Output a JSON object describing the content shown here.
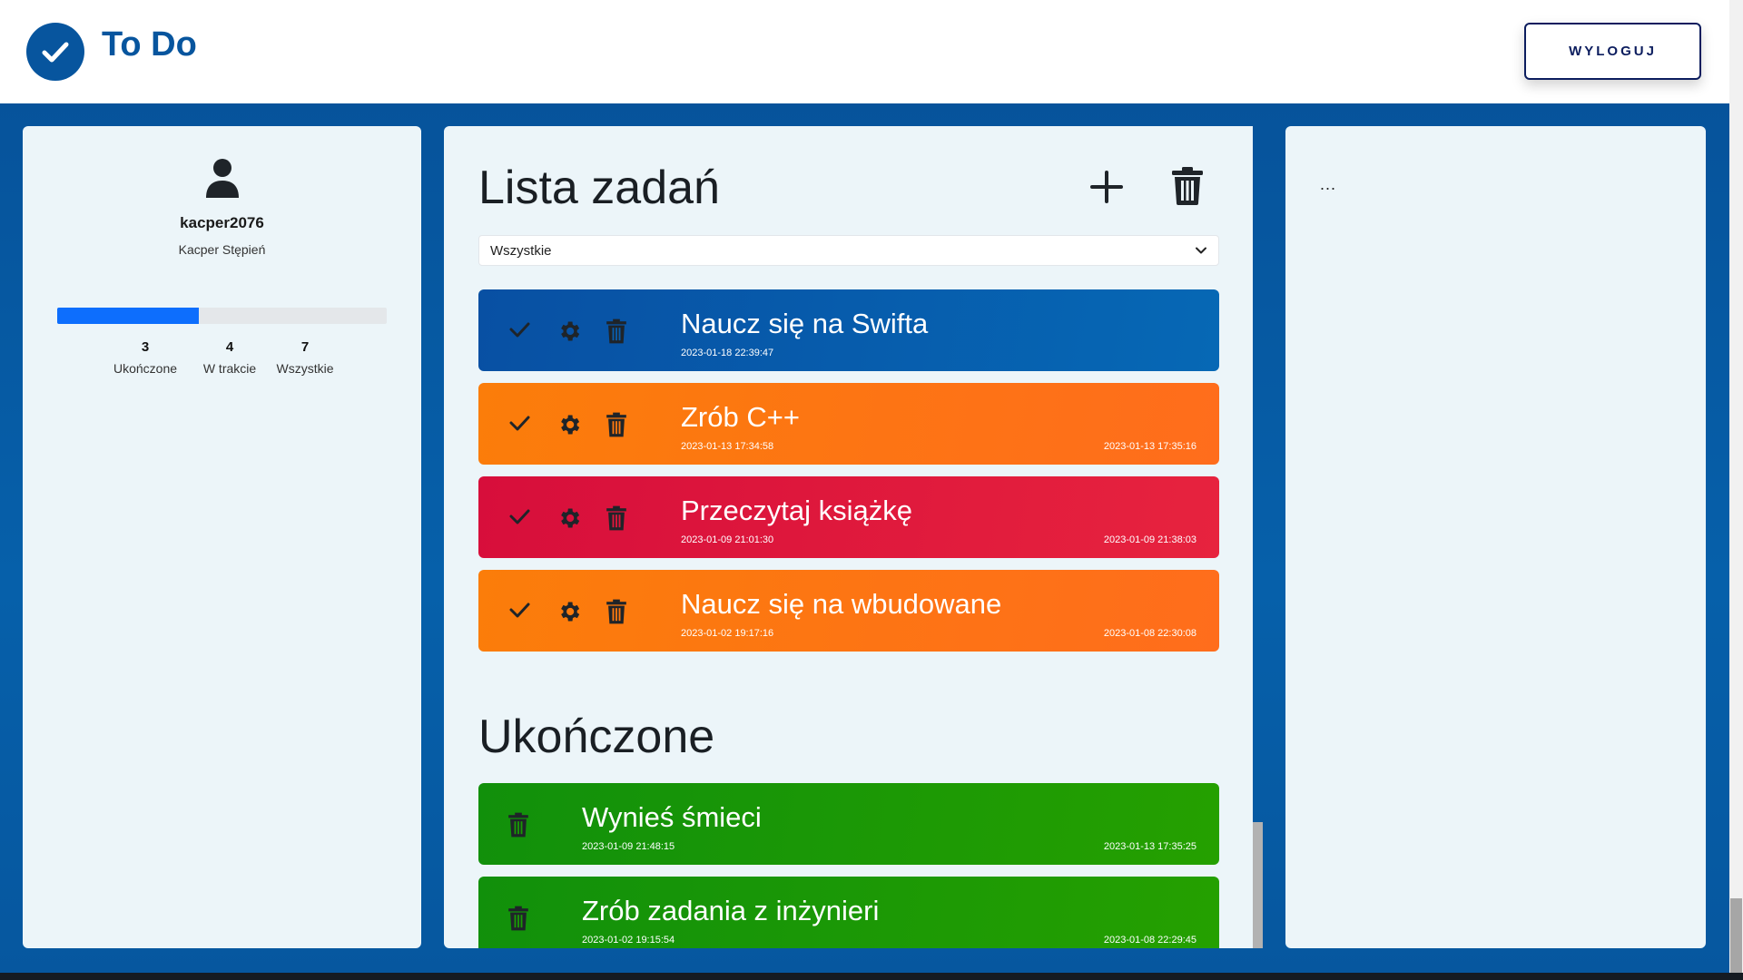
{
  "app": {
    "title": "To Do",
    "logout_label": "WYLOGUJ"
  },
  "profile": {
    "username": "kacper2076",
    "full_name": "Kacper Stępień",
    "progress_fraction": 0.43,
    "stats": [
      {
        "value": "3",
        "label": "Ukończone"
      },
      {
        "value": "4",
        "label": "W trakcie"
      },
      {
        "value": "7",
        "label": "Wszystkie"
      }
    ]
  },
  "task_list": {
    "title": "Lista zadań",
    "filter_value": "Wszystkie",
    "tasks": [
      {
        "title": "Naucz się na Swifta",
        "created": "2023-01-18 22:39:47",
        "deadline": "",
        "color": "#0a5dab"
      },
      {
        "title": "Zrób C++",
        "created": "2023-01-13 17:34:58",
        "deadline": "2023-01-13 17:35:16",
        "color": "#fd770f"
      },
      {
        "title": "Przeczytaj książkę",
        "created": "2023-01-09 21:01:30",
        "deadline": "2023-01-09 21:38:03",
        "color": "#dc163c"
      },
      {
        "title": "Naucz się na wbudowane",
        "created": "2023-01-02 19:17:16",
        "deadline": "2023-01-08 22:30:08",
        "color": "#fd770f"
      }
    ]
  },
  "completed": {
    "title": "Ukończone",
    "tasks": [
      {
        "title": "Wynieś śmieci",
        "created": "2023-01-09 21:48:15",
        "deadline": "2023-01-13 17:35:25",
        "color": "#1a9806"
      },
      {
        "title": "Zrób zadania z inżynieri",
        "created": "2023-01-02 19:15:54",
        "deadline": "2023-01-08 22:29:45",
        "color": "#1a9806"
      }
    ]
  },
  "detail_panel": {
    "placeholder": "..."
  },
  "icons": {
    "logo": "check-circle-icon",
    "user": "user-icon",
    "add": "plus-icon",
    "delete": "trash-icon",
    "complete": "check-icon",
    "edit": "gear-icon",
    "dropdown": "chevron-down-icon"
  }
}
